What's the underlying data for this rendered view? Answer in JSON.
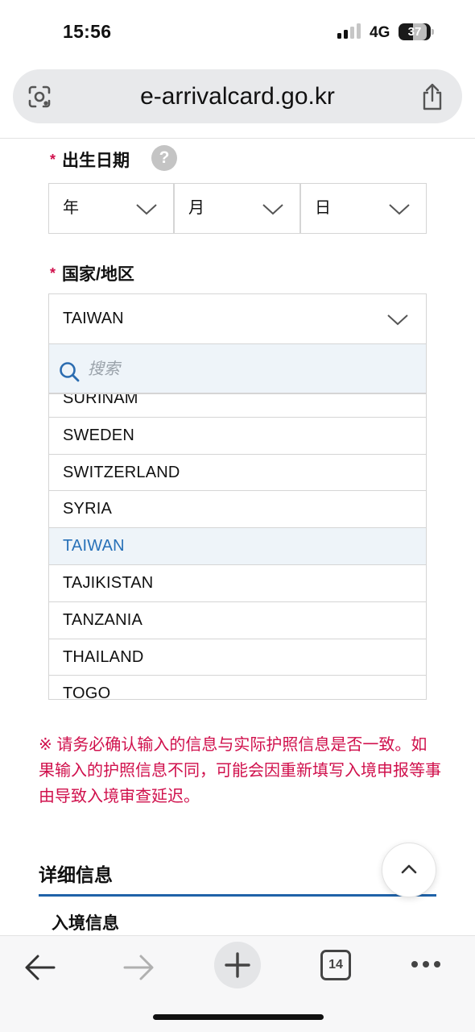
{
  "status_bar": {
    "time": "15:56",
    "network": "4G",
    "battery": "37"
  },
  "browser": {
    "url": "e-arrivalcard.go.kr",
    "tab_count": "14"
  },
  "form": {
    "birth_date": {
      "required_mark": "*",
      "label": "出生日期",
      "help_label": "?",
      "year": "年",
      "month": "月",
      "day": "日"
    },
    "country": {
      "required_mark": "*",
      "label": "国家/地区",
      "selected_value": "TAIWAN",
      "search_placeholder": "搜索",
      "options": [
        {
          "label": "SURINAM",
          "selected": false
        },
        {
          "label": "SWEDEN",
          "selected": false
        },
        {
          "label": "SWITZERLAND",
          "selected": false
        },
        {
          "label": "SYRIA",
          "selected": false
        },
        {
          "label": "TAIWAN",
          "selected": true
        },
        {
          "label": "TAJIKISTAN",
          "selected": false
        },
        {
          "label": "TANZANIA",
          "selected": false
        },
        {
          "label": "THAILAND",
          "selected": false
        },
        {
          "label": "TOGO",
          "selected": false
        }
      ]
    }
  },
  "notice": "※ 请务必确认输入的信息与实际护照信息是否一致。如果输入的护照信息不同，可能会因重新填写入境申报等事由导致入境审查延迟。",
  "section": {
    "title": "详细信息",
    "subtitle": "入境信息"
  },
  "colors": {
    "required": "#d0104c",
    "accent_blue": "#1f62a8",
    "selected_text": "#2871b8",
    "selected_bg": "#eef4f9"
  },
  "icons": [
    "lens-icon",
    "share-icon",
    "help-icon",
    "chevron-down-icon",
    "search-icon",
    "chevron-up-icon",
    "back-arrow-icon",
    "forward-arrow-icon",
    "plus-icon",
    "tabs-icon",
    "more-icon"
  ]
}
